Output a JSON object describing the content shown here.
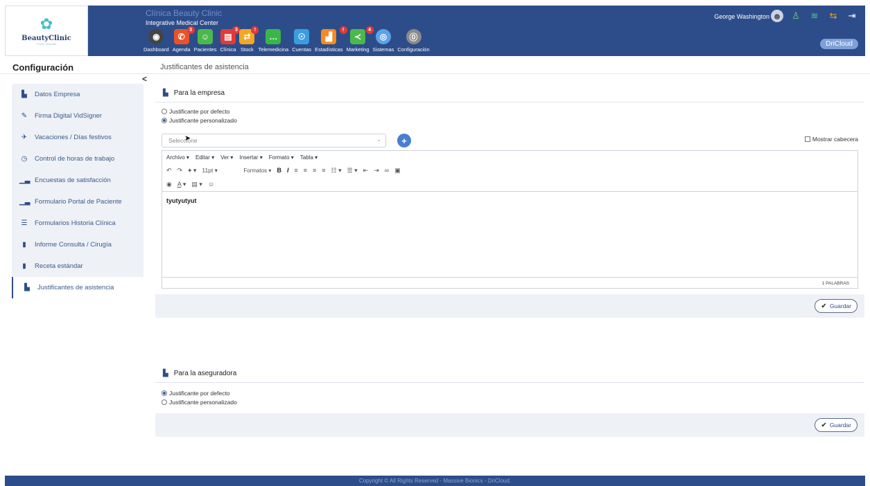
{
  "header": {
    "logo_name": "BeautyClinic",
    "logo_sub": "YOUR TAGLINE",
    "clinic_title": "Clínica Beauty Clinic",
    "clinic_subtitle": "Integrative Medical Center",
    "user_name": "George Washington",
    "brand": "DriCloud",
    "modules": [
      {
        "label": "Dashboard",
        "icon": "speedometer-icon",
        "color": "#e8532b",
        "badge": ""
      },
      {
        "label": "Agenda",
        "icon": "phone-icon",
        "color": "#e8532b",
        "badge": "3"
      },
      {
        "label": "Pacientes",
        "icon": "person-icon",
        "color": "#4cb84c",
        "badge": ""
      },
      {
        "label": "Clínica",
        "icon": "clipboard-icon",
        "color": "#e53935",
        "badge": "3"
      },
      {
        "label": "Stock",
        "icon": "box-icon",
        "color": "#f5a623",
        "badge": "!"
      },
      {
        "label": "Telemedicina",
        "icon": "chat-icon",
        "color": "#3bb54a",
        "badge": ""
      },
      {
        "label": "Cuentas",
        "icon": "accounts-icon",
        "color": "#3a9de0",
        "badge": ""
      },
      {
        "label": "Estadísticas",
        "icon": "chart-icon",
        "color": "#f58a23",
        "badge": "!"
      },
      {
        "label": "Marketing",
        "icon": "share-icon",
        "color": "#4cb84c",
        "badge": "4"
      },
      {
        "label": "Sistemas",
        "icon": "systems-icon",
        "color": "#5aa3e8",
        "badge": ""
      },
      {
        "label": "Configuración",
        "icon": "settings-icon",
        "color": "#8a8a8a",
        "badge": ""
      }
    ]
  },
  "subheader": {
    "section_title": "Configuración",
    "page_title": "Justificantes de asistencia"
  },
  "sidebar": {
    "items": [
      {
        "label": "Datos Empresa",
        "icon": "document-icon"
      },
      {
        "label": "Firma Digital VidSigner",
        "icon": "pen-icon"
      },
      {
        "label": "Vacaciones / Días festivos",
        "icon": "plane-icon"
      },
      {
        "label": "Control de horas de trabajo",
        "icon": "clock-icon"
      },
      {
        "label": "Encuestas de satisfacción",
        "icon": "bar-chart-icon"
      },
      {
        "label": "Formulario Portal de Paciente",
        "icon": "bar-chart-icon"
      },
      {
        "label": "Formularios Historia Clínica",
        "icon": "list-icon"
      },
      {
        "label": "Informe Consulta / Cirugía",
        "icon": "book-icon"
      },
      {
        "label": "Receta estándar",
        "icon": "book-icon"
      },
      {
        "label": "Justificantes de asistencia",
        "icon": "document-icon"
      }
    ]
  },
  "empresa": {
    "title": "Para la empresa",
    "radio_default": "Justificante por defecto",
    "radio_custom": "Justificante personalizado",
    "select_placeholder": "Seleccione",
    "show_header_label": "Mostrar cabecera",
    "editor": {
      "menus": [
        "Archivo",
        "Editar",
        "Ver",
        "Insertar",
        "Formato",
        "Tabla"
      ],
      "font_size": "11pt",
      "formats_label": "Formatos",
      "content": "tyutyutyut",
      "word_count": "1 PALABRAS"
    },
    "save_label": "Guardar"
  },
  "aseguradora": {
    "title": "Para la aseguradora",
    "radio_default": "Justificante por defecto",
    "radio_custom": "Justificante personalizado",
    "save_label": "Guardar"
  },
  "footer": {
    "text": "Copyright © All Rights Reserved - Massive Bionics - DriCloud."
  }
}
